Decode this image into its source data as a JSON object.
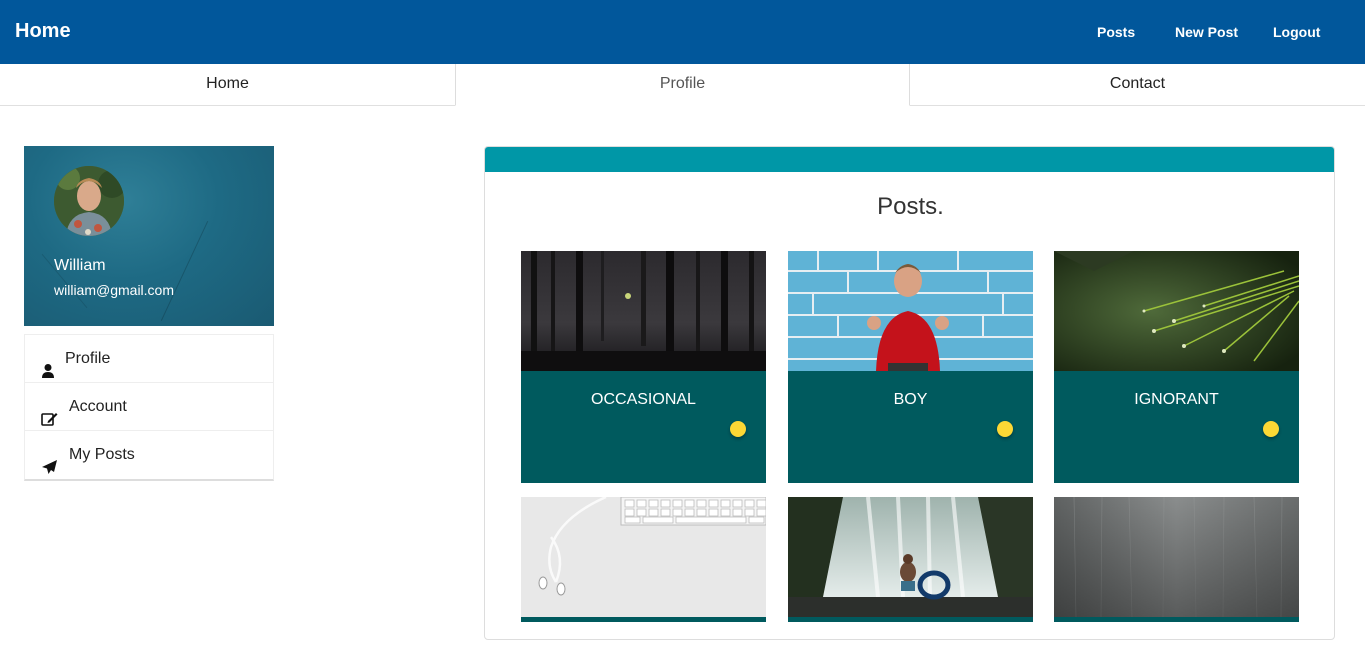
{
  "navbar": {
    "brand": "Home",
    "links": [
      "Posts",
      "New Post",
      "Logout"
    ],
    "color": "#01579b"
  },
  "tabs": [
    "Home",
    "Profile",
    "Contact"
  ],
  "active_tab": "Profile",
  "profile": {
    "name": "William",
    "email": "william@gmail.com"
  },
  "side_menu": [
    {
      "label": "Profile",
      "icon": "user-icon"
    },
    {
      "label": "Account",
      "icon": "edit-icon"
    },
    {
      "label": "My Posts",
      "icon": "paper-plane-icon"
    }
  ],
  "posts_panel": {
    "title": "Posts.",
    "header_color": "#0097a7",
    "card_color": "#005a5e",
    "dot_color": "#fdd835",
    "posts": [
      {
        "title": "OCCASIONAL"
      },
      {
        "title": "BOY"
      },
      {
        "title": "IGNORANT"
      },
      {
        "title": ""
      },
      {
        "title": ""
      },
      {
        "title": ""
      }
    ]
  }
}
